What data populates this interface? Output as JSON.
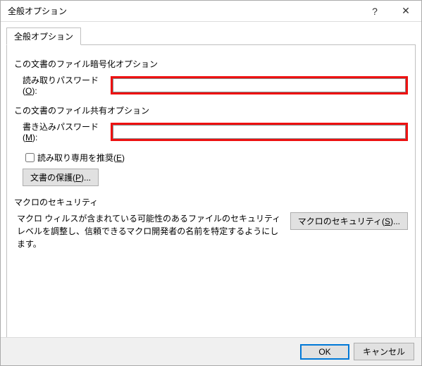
{
  "title": "全般オプション",
  "titlebar": {
    "help": "?",
    "close": "✕"
  },
  "tab_label": "全般オプション",
  "encrypt_section": "この文書のファイル暗号化オプション",
  "read_pw": {
    "label_pre": "読み取りパスワード(",
    "label_u": "O",
    "label_post": "):",
    "value": ""
  },
  "share_section": "この文書のファイル共有オプション",
  "write_pw": {
    "label_pre": "書き込みパスワード(",
    "label_u": "M",
    "label_post": "):",
    "value": ""
  },
  "readonly_rec": {
    "pre": "読み取り専用を推奨(",
    "u": "E",
    "post": ")",
    "checked": false
  },
  "protect_btn": {
    "pre": "文書の保護(",
    "u": "P",
    "post": ")..."
  },
  "macro_section": "マクロのセキュリティ",
  "macro_text": "マクロ ウィルスが含まれている可能性のあるファイルのセキュリティ レベルを調整し、信頼できるマクロ開発者の名前を特定するようにします。",
  "macro_btn": {
    "pre": "マクロのセキュリティ(",
    "u": "S",
    "post": ")..."
  },
  "footer": {
    "ok": "OK",
    "cancel": "キャンセル"
  }
}
